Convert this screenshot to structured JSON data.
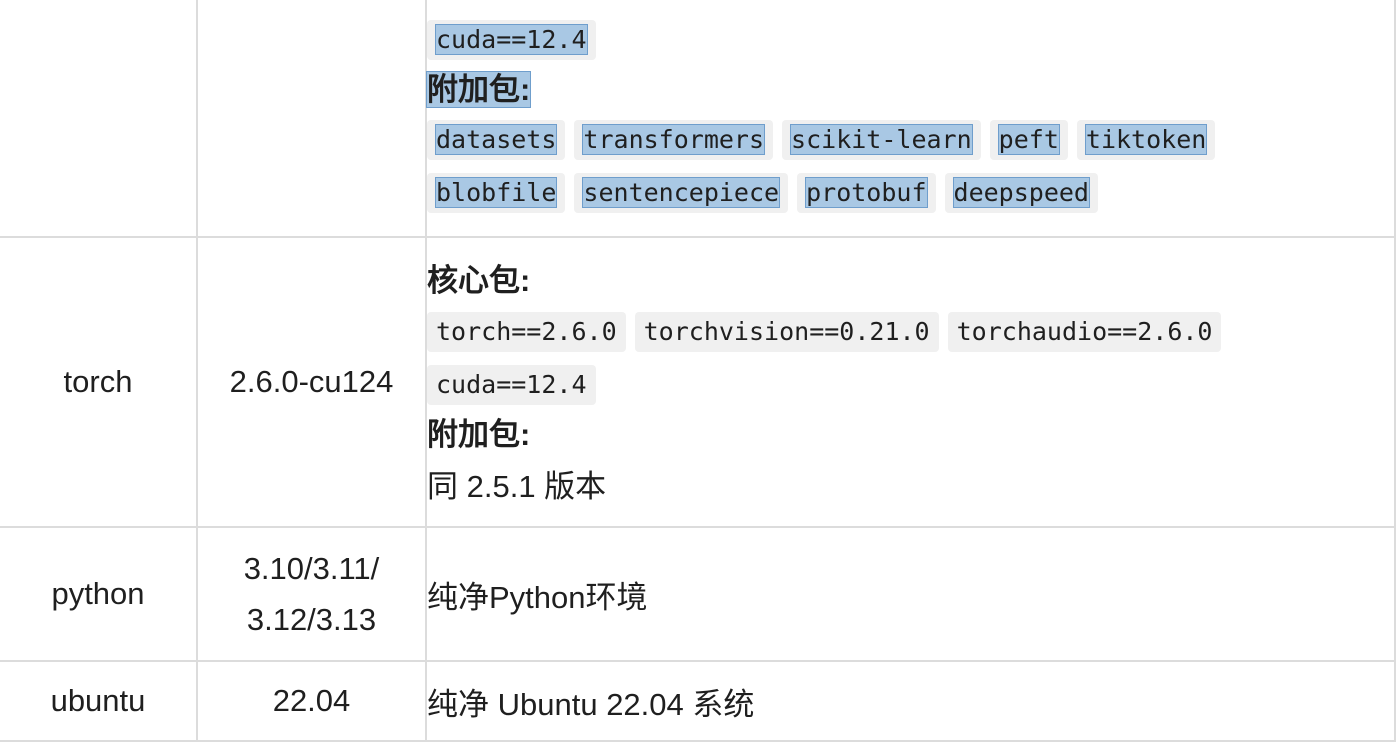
{
  "rows": [
    {
      "name": "",
      "version": "",
      "desc": {
        "core_packages": [
          "cuda==12.4"
        ],
        "extra_heading": "附加包:",
        "extra_packages": [
          "datasets",
          "transformers",
          "scikit-learn",
          "peft",
          "tiktoken",
          "blobfile",
          "sentencepiece",
          "protobuf",
          "deepspeed"
        ]
      }
    },
    {
      "name": "torch",
      "version": "2.6.0-cu124",
      "desc": {
        "core_heading": "核心包:",
        "core_packages": [
          "torch==2.6.0",
          "torchvision==0.21.0",
          "torchaudio==2.6.0",
          "cuda==12.4"
        ],
        "extra_heading": "附加包:",
        "extra_text": "同 2.5.1 版本"
      }
    },
    {
      "name": "python",
      "version_lines": [
        "3.10/3.11/",
        "3.12/3.13"
      ],
      "desc": {
        "text": "纯净Python环境"
      }
    },
    {
      "name": "ubuntu",
      "version": "22.04",
      "desc": {
        "text": "纯净 Ubuntu 22.04 系统"
      }
    }
  ]
}
